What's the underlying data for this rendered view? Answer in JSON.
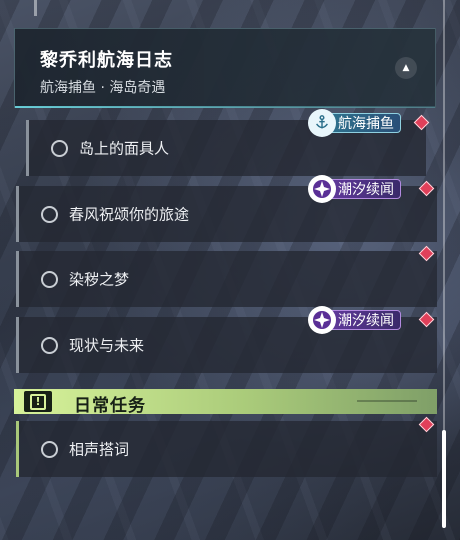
{
  "header": {
    "title": "黎乔利航海日志",
    "subtitle": "航海捕鱼 · 海岛奇遇",
    "collapse_icon": "chevron-up-icon"
  },
  "quests": [
    {
      "label": "岛上的面具人",
      "tag": "航海捕鱼",
      "tag_style": "teal"
    },
    {
      "label": "春风祝颂你的旅途",
      "tag": "潮汐续闻",
      "tag_style": "purple"
    },
    {
      "label": "染秽之梦",
      "tag": "",
      "tag_style": ""
    },
    {
      "label": "现状与未来",
      "tag": "潮汐续闻",
      "tag_style": "purple"
    }
  ],
  "daily_section": {
    "title": "日常任务",
    "icon": "exclamation-icon",
    "quests": [
      {
        "label": "相声搭词"
      }
    ]
  },
  "colors": {
    "accent_teal": "#6edce6",
    "daily_green": "#d7f29a",
    "tag_purple": "#6a3da8",
    "marker_red": "#e0405a"
  }
}
